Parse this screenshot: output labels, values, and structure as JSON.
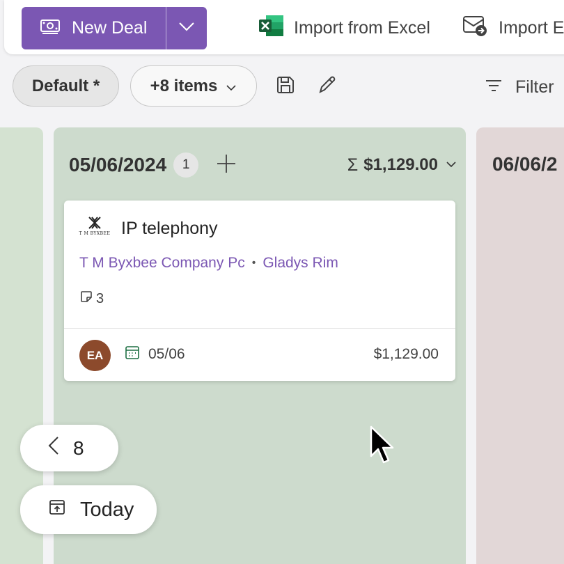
{
  "toolbar": {
    "new_deal_label": "New Deal",
    "import_excel_label": "Import from Excel",
    "import_email_label": "Import E"
  },
  "viewbar": {
    "view_name": "Default *",
    "items_label": "+8 items",
    "filter_label": "Filter"
  },
  "columns": {
    "main": {
      "date": "05/06/2024",
      "count": "1",
      "total": "$1,129.00"
    },
    "right": {
      "date": "06/06/2"
    }
  },
  "card": {
    "logo_text": "T M BYXBEE",
    "title": "IP telephony",
    "company": "T M Byxbee Company Pc",
    "contact": "Gladys Rim",
    "notes_count": "3",
    "owner_initials": "EA",
    "due_date": "05/06",
    "amount": "$1,129.00"
  },
  "nav": {
    "prev_count": "8",
    "today_label": "Today"
  },
  "colors": {
    "accent": "#7b57b3",
    "column_green": "#cddbcd",
    "column_pink": "#e2d7d7",
    "avatar": "#8c4a2c",
    "excel": "#1d6f42"
  },
  "icons": [
    "money-icon",
    "chevron-down-icon",
    "excel-icon",
    "email-import-icon",
    "save-icon",
    "edit-icon",
    "filter-icon",
    "sigma-icon",
    "plus-icon",
    "note-icon",
    "calendar-icon",
    "chevron-left-icon",
    "today-icon"
  ]
}
